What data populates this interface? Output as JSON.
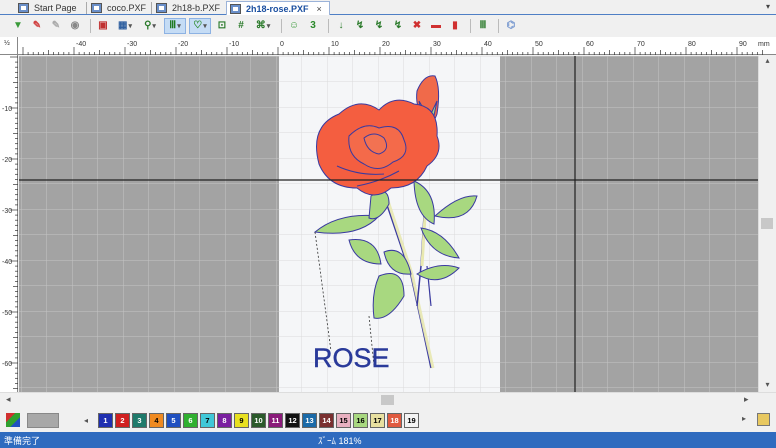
{
  "tabs": [
    {
      "label": "Start Page",
      "active": false
    },
    {
      "label": "coco.PXF",
      "active": false
    },
    {
      "label": "2h18-b.PXF",
      "active": false
    },
    {
      "label": "2h18-rose.PXF",
      "active": true
    }
  ],
  "tab_close": "×",
  "tab_menu": "▾",
  "ruler": {
    "unit": "mm",
    "corner_label": "½",
    "h_ticks": [
      "-40",
      "-30",
      "-20",
      "-10",
      "0",
      "10",
      "20",
      "30",
      "40",
      "50",
      "60",
      "70",
      "80",
      "90"
    ],
    "v_ticks": [
      "-10",
      "-20",
      "-30",
      "-40",
      "-50",
      "-60"
    ]
  },
  "design": {
    "text": "ROSE"
  },
  "scroll": {
    "left": "◂",
    "right": "▸",
    "up": "▴",
    "down": "▾"
  },
  "palette": {
    "colors": [
      {
        "n": "1",
        "bg": "#1f2fb0",
        "fg": "#ffffff"
      },
      {
        "n": "2",
        "bg": "#d02020",
        "fg": "#ffffff"
      },
      {
        "n": "3",
        "bg": "#1f7a6b",
        "fg": "#ffffff"
      },
      {
        "n": "4",
        "bg": "#f08a20",
        "fg": "#000000"
      },
      {
        "n": "5",
        "bg": "#2050c0",
        "fg": "#ffffff"
      },
      {
        "n": "6",
        "bg": "#30b030",
        "fg": "#ffffff"
      },
      {
        "n": "7",
        "bg": "#40c8d8",
        "fg": "#000000"
      },
      {
        "n": "8",
        "bg": "#7a1fa0",
        "fg": "#ffffff"
      },
      {
        "n": "9",
        "bg": "#e8e020",
        "fg": "#000000"
      },
      {
        "n": "10",
        "bg": "#2b5a2b",
        "fg": "#ffffff"
      },
      {
        "n": "11",
        "bg": "#8a1a7a",
        "fg": "#ffffff"
      },
      {
        "n": "12",
        "bg": "#111111",
        "fg": "#ffffff"
      },
      {
        "n": "13",
        "bg": "#1a6aa8",
        "fg": "#ffffff"
      },
      {
        "n": "14",
        "bg": "#7a3030",
        "fg": "#ffffff"
      },
      {
        "n": "15",
        "bg": "#e8b0c0",
        "fg": "#000000"
      },
      {
        "n": "16",
        "bg": "#a8d880",
        "fg": "#000000"
      },
      {
        "n": "17",
        "bg": "#e8e0a0",
        "fg": "#000000"
      },
      {
        "n": "18",
        "bg": "#e05a40",
        "fg": "#ffffff"
      },
      {
        "n": "19",
        "bg": "#f4f4f4",
        "fg": "#000000"
      }
    ]
  },
  "status": {
    "left": "準備完了",
    "zoom": "ｽﾞｰﾑ 181%"
  },
  "colors": {
    "status_bg": "#2f6bbf",
    "canvas_bg": "#a3a3a3",
    "tab_accent": "#1a4fa0"
  }
}
